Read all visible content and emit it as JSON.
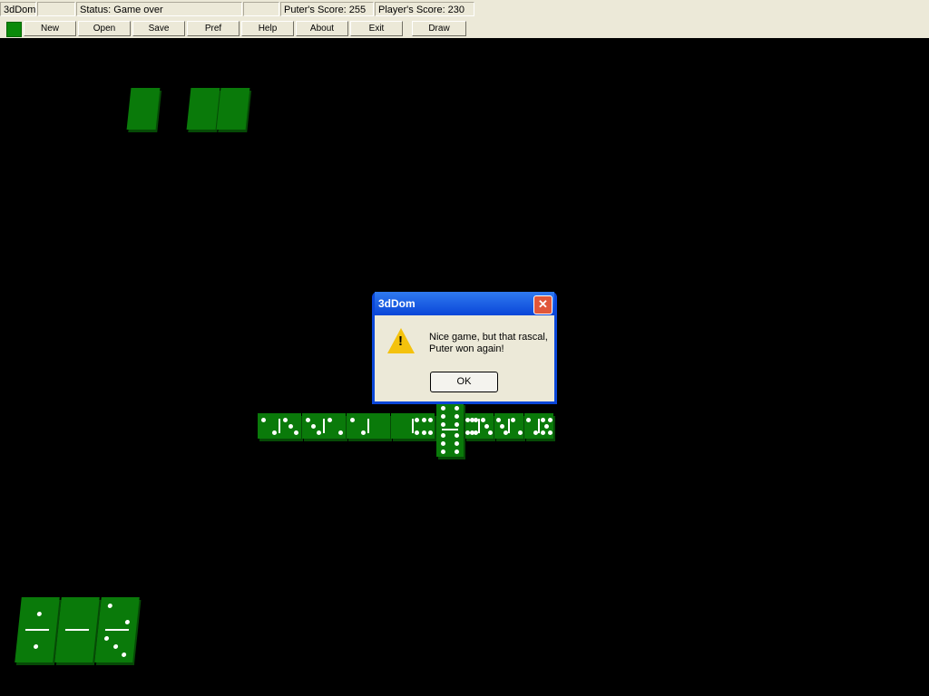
{
  "status_bar": {
    "app": "3dDom",
    "blank1": "",
    "status": "Status: Game over",
    "blank2": "",
    "puter_score": "Puter's Score: 255",
    "player_score": "Player's Score: 230"
  },
  "toolbar": {
    "icon": "domino-app-icon",
    "buttons": [
      "New",
      "Open",
      "Save",
      "Pref",
      "Help",
      "About",
      "Exit",
      "Draw"
    ]
  },
  "game": {
    "opponent_hand_count": 3,
    "chain": [
      [
        2,
        3
      ],
      [
        3,
        2
      ],
      [
        2,
        0
      ],
      [
        0,
        6
      ],
      [
        6,
        3
      ],
      [
        3,
        2
      ],
      [
        2,
        5
      ]
    ],
    "spinner": [
      6,
      6
    ],
    "player_hand": [
      [
        1,
        1
      ],
      [
        0,
        0
      ],
      [
        2,
        3
      ]
    ],
    "table_color": "#000000",
    "tile_color": "#0a7a0a"
  },
  "dialog": {
    "title": "3dDom",
    "message": "Nice game, but that rascal, Puter won again!",
    "ok": "OK",
    "icon": "warning-icon"
  }
}
